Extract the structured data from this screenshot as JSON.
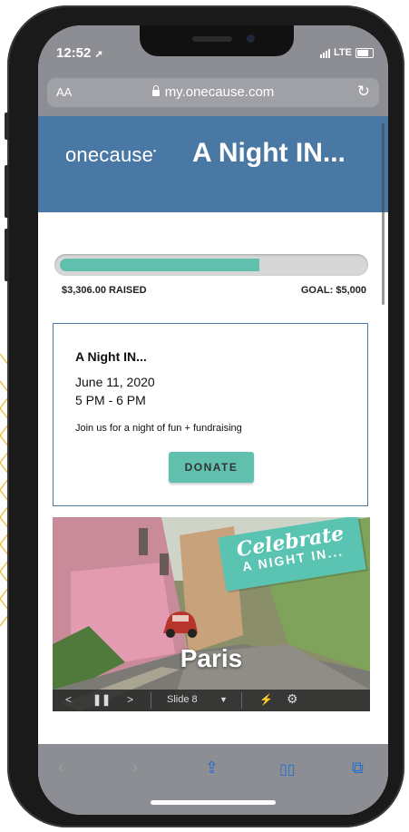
{
  "status_bar": {
    "time": "12:52",
    "network": "LTE"
  },
  "browser": {
    "text_size": "AA",
    "url": "my.onecause.com"
  },
  "header": {
    "brand": "onecause",
    "brand_mark": "•",
    "event_name": "A Night IN..."
  },
  "fundraising": {
    "raised_label": "$3,306.00 RAISED",
    "goal_label": "GOAL: $5,000",
    "progress_fraction": 0.66
  },
  "event": {
    "title": "A Night IN...",
    "date": "June 11, 2020",
    "time": "5 PM - 6 PM",
    "description": "Join us for a night of fun + fundraising",
    "donate_label": "DONATE"
  },
  "slideshow": {
    "banner_line1": "Celebrate",
    "banner_line2": "A NIGHT IN...",
    "caption": "Paris",
    "slide_label": "Slide 8",
    "icons": [
      "prev-icon",
      "pause-icon",
      "next-icon",
      "dropdown-icon",
      "lightning-icon",
      "gear-icon"
    ]
  },
  "colors": {
    "accent": "#61bfad",
    "header_blue": "#4a78a5",
    "safari_active": "#1f6fd1"
  },
  "toolbar_icons": [
    "back-icon",
    "forward-icon",
    "share-icon",
    "bookmarks-icon",
    "tabs-icon"
  ]
}
